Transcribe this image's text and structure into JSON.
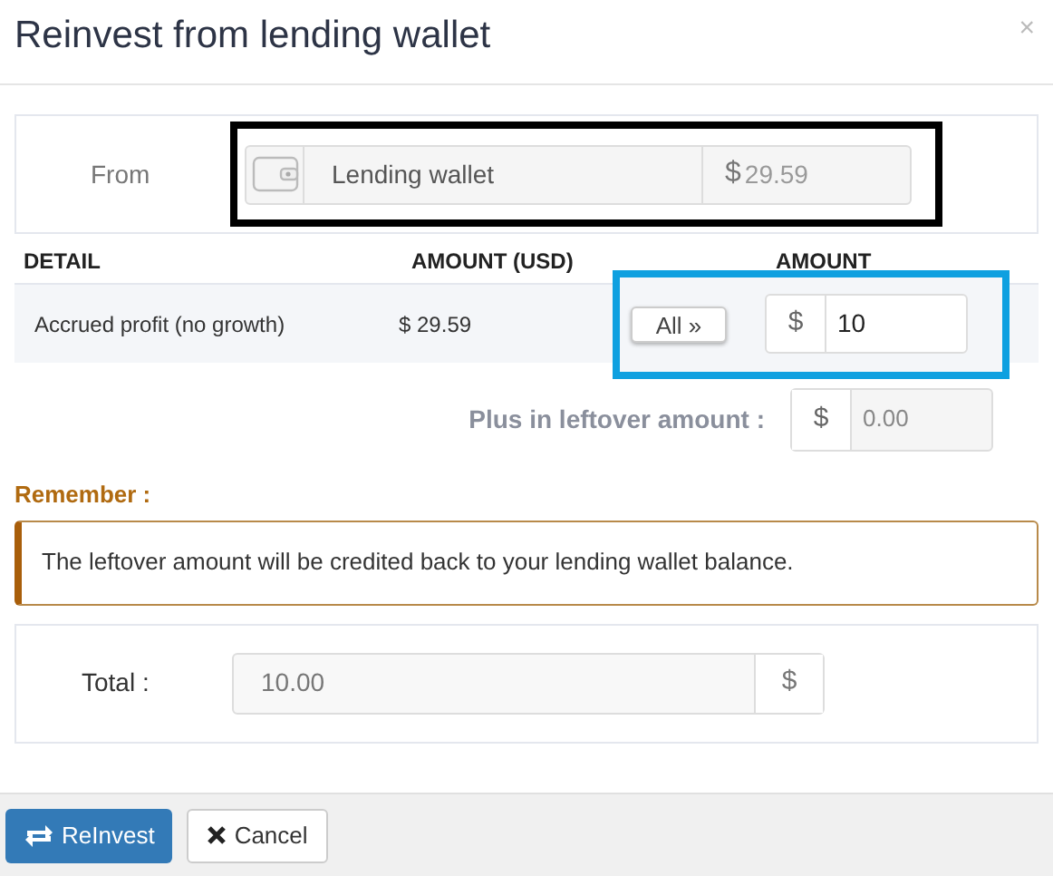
{
  "dialog": {
    "title": "Reinvest from lending wallet",
    "close": "×"
  },
  "from": {
    "label": "From",
    "wallet": "Lending wallet",
    "currency": "$",
    "balance": "29.59"
  },
  "table": {
    "columns": [
      "DETAIL",
      "AMOUNT (USD)",
      "AMOUNT"
    ],
    "rows": [
      {
        "detail": "Accrued profit (no growth)",
        "amount_usd": "$ 29.59",
        "all_button": "All »",
        "currency": "$",
        "amount": "10"
      }
    ]
  },
  "leftover": {
    "label": "Plus in leftover amount :",
    "currency": "$",
    "value": "0.00"
  },
  "remember": {
    "title": "Remember :",
    "text": "The leftover amount will be credited back to your lending wallet balance."
  },
  "total": {
    "label": "Total :",
    "value": "10.00",
    "currency": "$"
  },
  "buttons": [
    {
      "kind": "primary",
      "label": "ReInvest"
    },
    {
      "kind": "default",
      "label": "Cancel"
    }
  ]
}
